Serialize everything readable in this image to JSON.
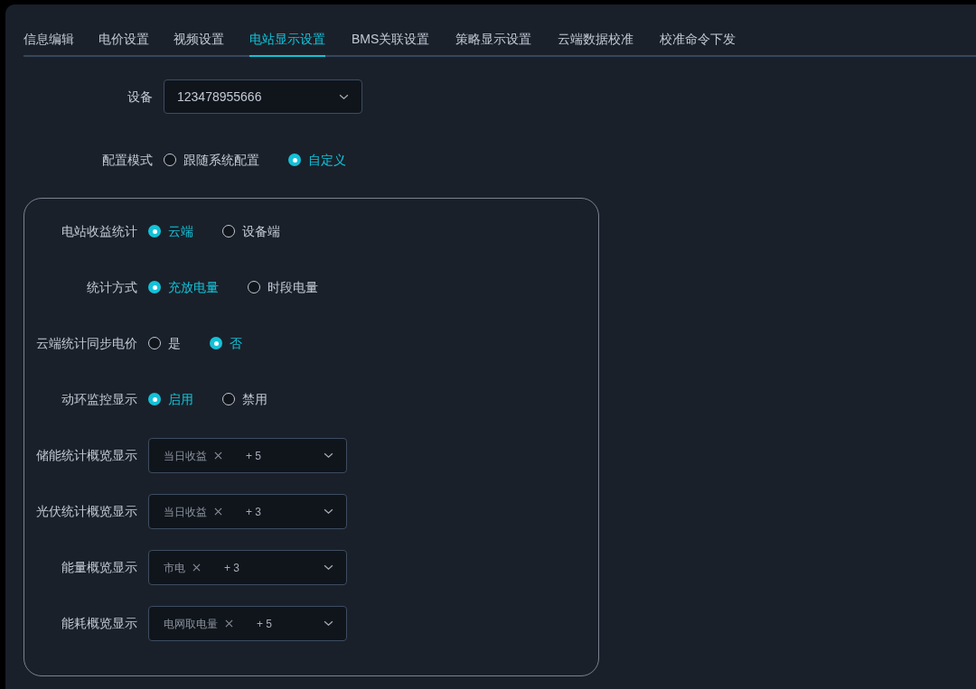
{
  "tabs": [
    {
      "label": "信息编辑",
      "selected": false
    },
    {
      "label": "电价设置",
      "selected": false
    },
    {
      "label": "视频设置",
      "selected": false
    },
    {
      "label": "电站显示设置",
      "selected": true
    },
    {
      "label": "BMS关联设置",
      "selected": false
    },
    {
      "label": "策略显示设置",
      "selected": false
    },
    {
      "label": "云端数据校准",
      "selected": false
    },
    {
      "label": "校准命令下发",
      "selected": false
    }
  ],
  "device": {
    "label": "设备",
    "value": "123478955666"
  },
  "config_mode": {
    "label": "配置模式",
    "options": [
      {
        "label": "跟随系统配置",
        "selected": false
      },
      {
        "label": "自定义",
        "selected": true
      }
    ]
  },
  "settings": [
    {
      "kind": "radio",
      "label": "电站收益统计",
      "options": [
        {
          "label": "云端",
          "selected": true
        },
        {
          "label": "设备端",
          "selected": false
        }
      ]
    },
    {
      "kind": "radio",
      "label": "统计方式",
      "options": [
        {
          "label": "充放电量",
          "selected": true
        },
        {
          "label": "时段电量",
          "selected": false
        }
      ]
    },
    {
      "kind": "radio",
      "label": "云端统计同步电价",
      "options": [
        {
          "label": "是",
          "selected": false
        },
        {
          "label": "否",
          "selected": true
        }
      ]
    },
    {
      "kind": "radio",
      "label": "动环监控显示",
      "options": [
        {
          "label": "启用",
          "selected": true
        },
        {
          "label": "禁用",
          "selected": false
        }
      ]
    },
    {
      "kind": "multiselect",
      "label": "储能统计概览显示",
      "tags": [
        "当日收益"
      ],
      "more": "+ 5"
    },
    {
      "kind": "multiselect",
      "label": "光伏统计概览显示",
      "tags": [
        "当日收益"
      ],
      "more": "+ 3"
    },
    {
      "kind": "multiselect",
      "label": "能量概览显示",
      "tags": [
        "市电"
      ],
      "more": "+ 3"
    },
    {
      "kind": "multiselect",
      "label": "能耗概览显示",
      "tags": [
        "电网取电量"
      ],
      "more": "+ 5"
    }
  ]
}
